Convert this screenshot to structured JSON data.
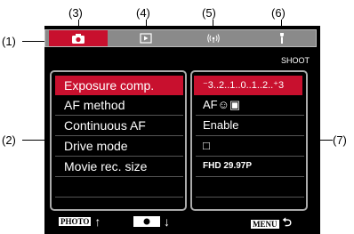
{
  "callouts": {
    "c1": "(1)",
    "c2": "(2)",
    "c3": "(3)",
    "c4": "(4)",
    "c5": "(5)",
    "c6": "(6)",
    "c7": "(7)"
  },
  "tabs": [
    {
      "icon": "camera-icon",
      "glyph": "📷",
      "active": true
    },
    {
      "icon": "playback-icon",
      "glyph": "▶",
      "active": false
    },
    {
      "icon": "wireless-icon",
      "glyph": "((•))",
      "active": false
    },
    {
      "icon": "wrench-icon",
      "glyph": "🔧",
      "active": false
    }
  ],
  "tab_label": "SHOOT",
  "menu_items": [
    {
      "label": "Exposure comp.",
      "value": "⁻3..2..1..0..1..2..⁺3",
      "selected": true
    },
    {
      "label": "AF method",
      "value": "AF☺▣",
      "selected": false
    },
    {
      "label": "Continuous AF",
      "value": "Enable",
      "selected": false
    },
    {
      "label": "Drive mode",
      "value": "□",
      "selected": false
    },
    {
      "label": "Movie rec. size",
      "value": "FHD 29.97P",
      "selected": false
    }
  ],
  "bottom_bar": {
    "photo_label": "PHOTO",
    "photo_arrow": "↑",
    "record_arrow": "↓",
    "menu_label": "MENU",
    "menu_arrow": "⮌"
  },
  "colors": {
    "accent": "#c8102e",
    "screen_bg": "#000000",
    "tab_bg": "#8a8a8a"
  }
}
